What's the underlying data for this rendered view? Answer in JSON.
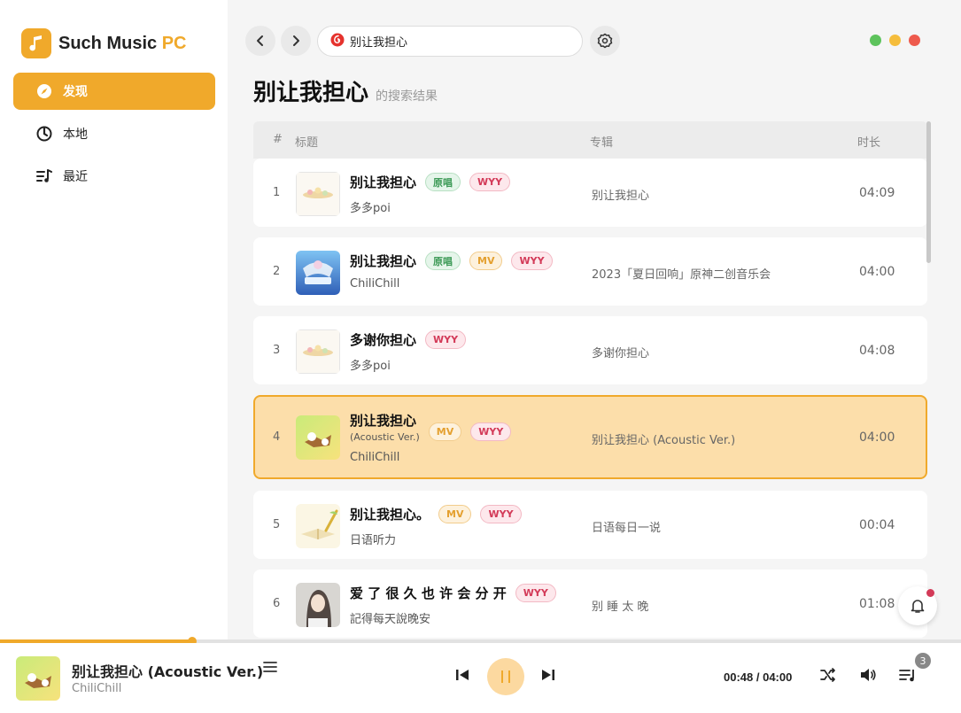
{
  "app": {
    "name": "Such Music",
    "name_suffix": "PC",
    "accent": "#f0a92b"
  },
  "sidebar": {
    "items": [
      {
        "label": "发现",
        "icon": "compass-icon",
        "active": true
      },
      {
        "label": "本地",
        "icon": "local-disc-icon",
        "active": false
      },
      {
        "label": "最近",
        "icon": "recent-list-icon",
        "active": false
      }
    ]
  },
  "topbar": {
    "search_value": "别让我担心",
    "search_icon": "netease-icon",
    "window_dots": [
      "#5dc35c",
      "#f5bd3c",
      "#ee5a4d"
    ]
  },
  "page": {
    "title": "别让我担心",
    "subtitle": "的搜索结果"
  },
  "table": {
    "headers": {
      "num": "#",
      "title": "标题",
      "album": "专辑",
      "duration": "时长"
    },
    "rows": [
      {
        "num": "1",
        "title": "别让我担心",
        "subtitle": "",
        "tags": [
          "原唱",
          "WYY"
        ],
        "artist": "多多poi",
        "album": "别让我担心",
        "duration": "04:09"
      },
      {
        "num": "2",
        "title": "别让我担心",
        "subtitle": "",
        "tags": [
          "原唱",
          "MV",
          "WYY"
        ],
        "artist": "ChiliChill",
        "album": "2023「夏日回响」原神二创音乐会",
        "duration": "04:00"
      },
      {
        "num": "3",
        "title": "多谢你担心",
        "subtitle": "",
        "tags": [
          "WYY"
        ],
        "artist": "多多poi",
        "album": "多谢你担心",
        "duration": "04:08"
      },
      {
        "num": "4",
        "title": "别让我担心",
        "subtitle": "(Acoustic Ver.)",
        "tags": [
          "MV",
          "WYY"
        ],
        "artist": "ChiliChill",
        "album": "别让我担心 (Acoustic Ver.)",
        "duration": "04:00"
      },
      {
        "num": "5",
        "title": "别让我担心。",
        "subtitle": "",
        "tags": [
          "MV",
          "WYY"
        ],
        "artist": "日语听力",
        "album": "日语每日一说",
        "duration": "00:04"
      },
      {
        "num": "6",
        "title": "爱 了 很 久 也 许 会 分 开",
        "subtitle": "",
        "tags": [
          "WYY"
        ],
        "artist": "記得每天說晚安",
        "album": "别 睡 太 晚",
        "duration": "01:08"
      }
    ]
  },
  "player": {
    "title": "别让我担心 (Acoustic Ver.)",
    "artist": "ChiliChill",
    "time": "00:48 / 04:00",
    "progress": 0.2,
    "queue_count": "3"
  }
}
